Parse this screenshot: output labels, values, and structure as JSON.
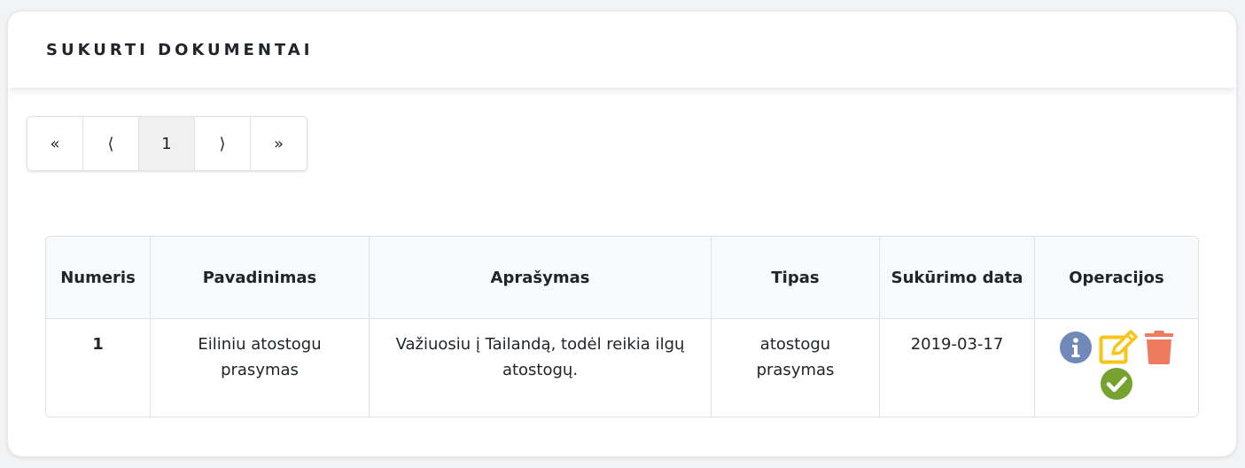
{
  "card": {
    "title": "SUKURTI DOKUMENTAI"
  },
  "pagination": {
    "first": "«",
    "prev": "⟨",
    "current": "1",
    "next": "⟩",
    "last": "»"
  },
  "table": {
    "headers": {
      "numeris": "Numeris",
      "pavadinimas": "Pavadinimas",
      "aprasymas": "Aprašymas",
      "tipas": "Tipas",
      "sukurimo_data": "Sukūrimo data",
      "operacijos": "Operacijos"
    },
    "rows": [
      {
        "numeris": "1",
        "pavadinimas": "Eiliniu atostogu prasymas",
        "aprasymas": "Važiuosiu į Tailandą, todėl reikia ilgų atostogų.",
        "tipas": "atostogu prasymas",
        "sukurimo_data": "2019-03-17",
        "operations": [
          "info-icon",
          "edit-icon",
          "trash-icon",
          "check-icon"
        ]
      }
    ]
  },
  "colors": {
    "info": "#7089b8",
    "edit": "#f5c518",
    "delete": "#ef7b5f",
    "approve": "#78a22f"
  }
}
